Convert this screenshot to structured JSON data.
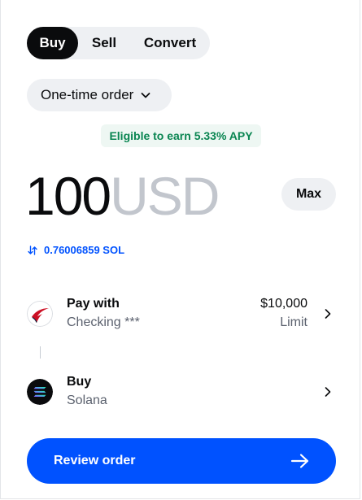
{
  "tabs": [
    {
      "label": "Buy",
      "active": true
    },
    {
      "label": "Sell",
      "active": false
    },
    {
      "label": "Convert",
      "active": false
    }
  ],
  "order_type": {
    "label": "One-time order",
    "icon": "chevron-down-icon"
  },
  "apy_badge": "Eligible to earn 5.33% APY",
  "amount": {
    "value": "100",
    "currency": "USD"
  },
  "max_label": "Max",
  "conversion": {
    "icon": "swap-arrows-icon",
    "text": "0.76006859 SOL"
  },
  "payment": {
    "title": "Pay with",
    "subtitle": "Checking ***",
    "amount": "$10,000",
    "amount_caption": "Limit",
    "icon": "bank-logo-icon"
  },
  "asset": {
    "title": "Buy",
    "subtitle": "Solana",
    "icon": "solana-logo-icon"
  },
  "review_button": {
    "label": "Review order",
    "icon": "arrow-right-icon"
  },
  "colors": {
    "accent": "#0052ff",
    "apy_green": "#098551",
    "muted": "#5b616e",
    "currency_gray": "#c2c6cd"
  }
}
